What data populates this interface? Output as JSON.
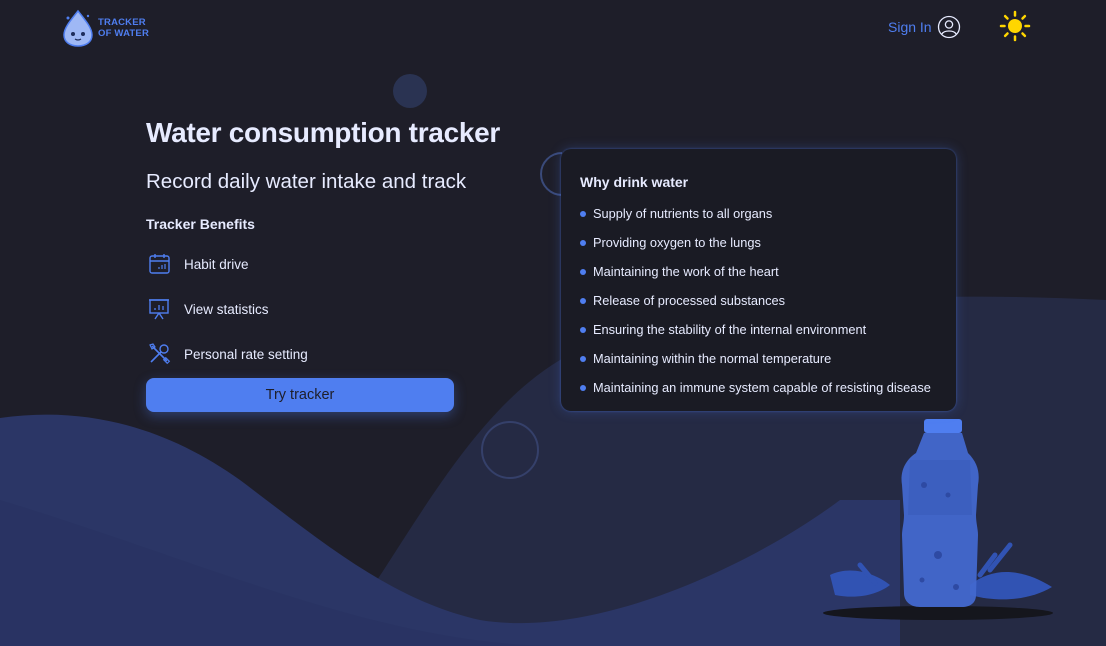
{
  "header": {
    "logo": {
      "line1": "TRACKER",
      "line2": "OF WATER"
    },
    "signin_label": "Sign In",
    "icons": {
      "user": "user-circle-icon",
      "theme": "sun-icon"
    }
  },
  "hero": {
    "title": "Water consumption tracker",
    "subtitle": "Record daily water intake and track",
    "benefits_title": "Tracker Benefits",
    "benefits": [
      {
        "label": "Habit drive",
        "icon": "calendar-icon"
      },
      {
        "label": "View statistics",
        "icon": "presentation-chart-icon"
      },
      {
        "label": "Personal rate setting",
        "icon": "tools-icon"
      }
    ],
    "cta_label": "Try tracker"
  },
  "why_card": {
    "title": "Why drink water",
    "items": [
      "Supply of nutrients to all organs",
      "Providing oxygen to the lungs",
      "Maintaining the work of the heart",
      "Release of processed substances",
      "Ensuring the stability of the internal environment",
      "Maintaining within the normal temperature",
      "Maintaining an immune system capable of resisting disease"
    ]
  },
  "colors": {
    "background": "#1e1e29",
    "accent": "#4f7ef0",
    "text": "#e7ebff",
    "wave": "#2b3666",
    "sun": "#ffd600"
  }
}
